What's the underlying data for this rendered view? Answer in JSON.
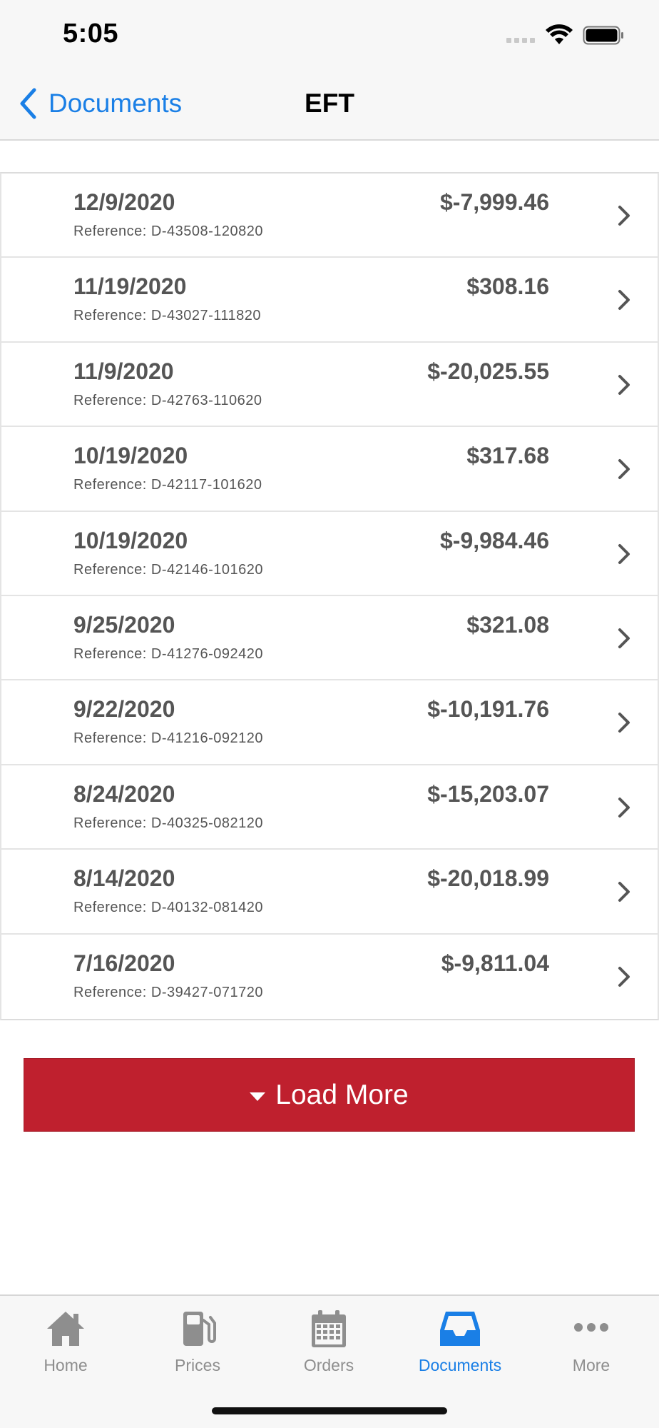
{
  "status_bar": {
    "time": "5:05"
  },
  "nav": {
    "back_label": "Documents",
    "title": "EFT"
  },
  "rows": [
    {
      "date": "12/9/2020",
      "reference": "Reference: D-43508-120820",
      "amount": "$-7,999.46"
    },
    {
      "date": "11/19/2020",
      "reference": "Reference: D-43027-111820",
      "amount": "$308.16"
    },
    {
      "date": "11/9/2020",
      "reference": "Reference: D-42763-110620",
      "amount": "$-20,025.55"
    },
    {
      "date": "10/19/2020",
      "reference": "Reference: D-42117-101620",
      "amount": "$317.68"
    },
    {
      "date": "10/19/2020",
      "reference": "Reference: D-42146-101620",
      "amount": "$-9,984.46"
    },
    {
      "date": "9/25/2020",
      "reference": "Reference: D-41276-092420",
      "amount": "$321.08"
    },
    {
      "date": "9/22/2020",
      "reference": "Reference: D-41216-092120",
      "amount": "$-10,191.76"
    },
    {
      "date": "8/24/2020",
      "reference": "Reference: D-40325-082120",
      "amount": "$-15,203.07"
    },
    {
      "date": "8/14/2020",
      "reference": "Reference: D-40132-081420",
      "amount": "$-20,018.99"
    },
    {
      "date": "7/16/2020",
      "reference": "Reference: D-39427-071720",
      "amount": "$-9,811.04"
    }
  ],
  "load_more": {
    "label": "Load More",
    "color": "#bf202e"
  },
  "tabs": [
    {
      "label": "Home",
      "icon": "home-icon"
    },
    {
      "label": "Prices",
      "icon": "gas-pump-icon"
    },
    {
      "label": "Orders",
      "icon": "calendar-icon"
    },
    {
      "label": "Documents",
      "icon": "inbox-icon",
      "active": true
    },
    {
      "label": "More",
      "icon": "more-dots-icon"
    }
  ],
  "colors": {
    "accent": "#1a7fe6",
    "inactive": "#8e8e8e"
  }
}
